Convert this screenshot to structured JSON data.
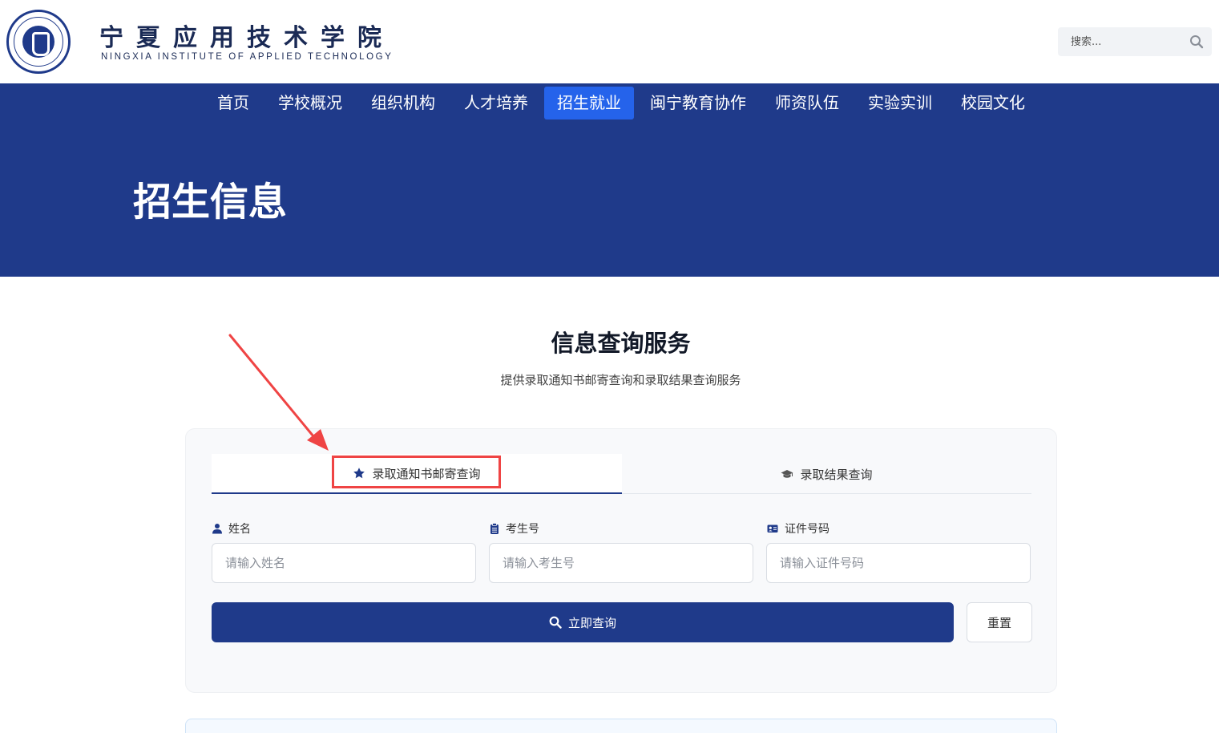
{
  "header": {
    "school_name_cn": "宁夏应用技术学院",
    "school_name_en": "NINGXIA INSTITUTE OF APPLIED TECHNOLOGY",
    "logo_icon": "school-seal-logo",
    "search_placeholder": "搜索...",
    "search_icon": "search-icon"
  },
  "nav": {
    "items": [
      {
        "label": "首页"
      },
      {
        "label": "学校概况"
      },
      {
        "label": "组织机构"
      },
      {
        "label": "人才培养"
      },
      {
        "label": "招生就业",
        "active": true
      },
      {
        "label": "闽宁教育协作"
      },
      {
        "label": "师资队伍"
      },
      {
        "label": "实验实训"
      },
      {
        "label": "校园文化"
      }
    ]
  },
  "banner": {
    "title": "招生信息"
  },
  "section": {
    "title": "信息查询服务",
    "subtitle": "提供录取通知书邮寄查询和录取结果查询服务"
  },
  "query": {
    "tabs": [
      {
        "label": "录取通知书邮寄查询",
        "icon": "star-icon",
        "active": true
      },
      {
        "label": "录取结果查询",
        "icon": "graduation-cap-icon",
        "active": false
      }
    ],
    "fields": [
      {
        "label": "姓名",
        "icon": "user-icon",
        "placeholder": "请输入姓名"
      },
      {
        "label": "考生号",
        "icon": "clipboard-icon",
        "placeholder": "请输入考生号"
      },
      {
        "label": "证件号码",
        "icon": "id-card-icon",
        "placeholder": "请输入证件号码"
      }
    ],
    "submit_label": "立即查询",
    "reset_label": "重置"
  },
  "colors": {
    "primary": "#1f3a8a",
    "nav_active": "#2563eb",
    "annotation": "#ef4444",
    "card_bg": "#f8f9fb"
  }
}
